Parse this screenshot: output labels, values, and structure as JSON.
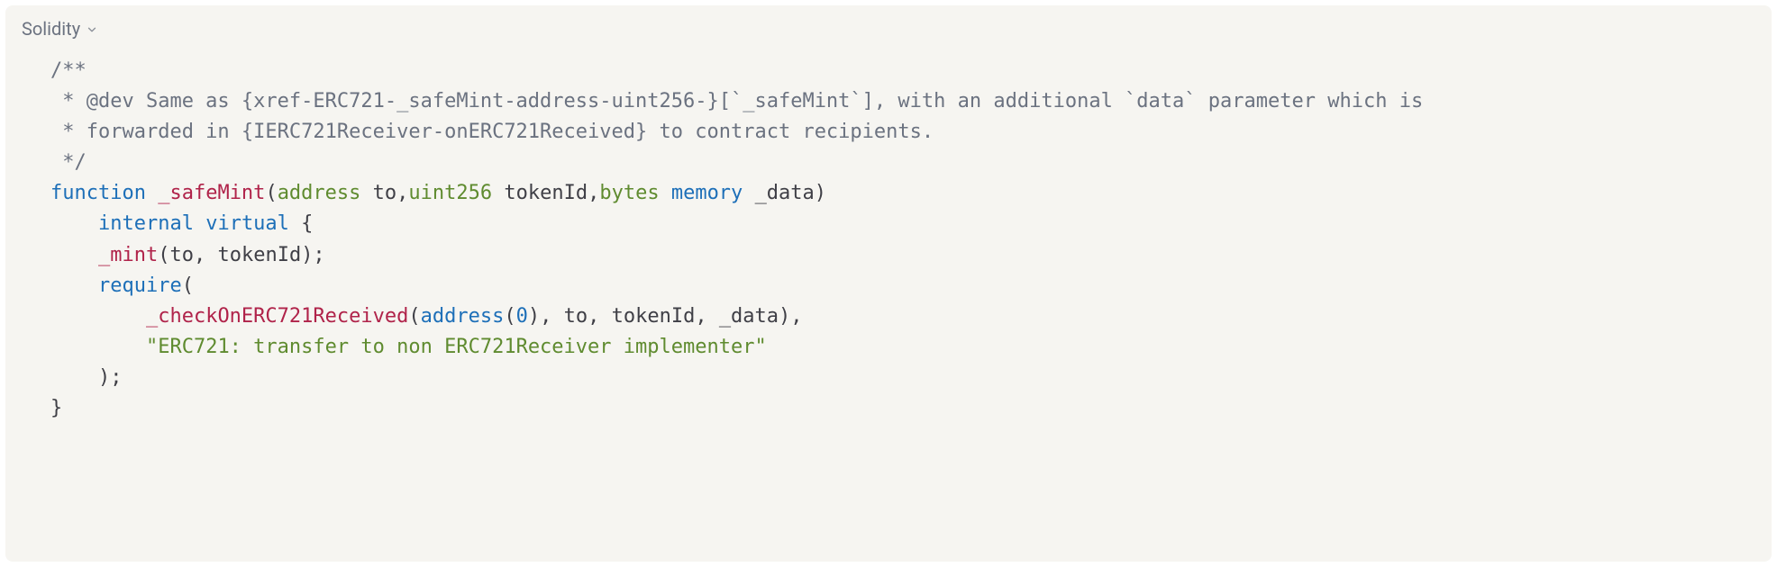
{
  "language": "Solidity",
  "tokens": [
    [
      [
        "comment",
        "/**"
      ]
    ],
    [
      [
        "comment",
        " * @dev Same as {xref-ERC721-_safeMint-address-uint256-}[`_safeMint`], with an additional `data` parameter which is"
      ]
    ],
    [
      [
        "comment",
        " * forwarded in {IERC721Receiver-onERC721Received} to contract recipients."
      ]
    ],
    [
      [
        "comment",
        " */"
      ]
    ],
    [
      [
        "keyword",
        "function"
      ],
      [
        "punct",
        " "
      ],
      [
        "fn",
        "_safeMint"
      ],
      [
        "punct",
        "("
      ],
      [
        "type",
        "address"
      ],
      [
        "punct",
        " "
      ],
      [
        "ident",
        "to"
      ],
      [
        "punct",
        ","
      ],
      [
        "type",
        "uint256"
      ],
      [
        "punct",
        " "
      ],
      [
        "ident",
        "tokenId"
      ],
      [
        "punct",
        ","
      ],
      [
        "type",
        "bytes"
      ],
      [
        "punct",
        " "
      ],
      [
        "keyword",
        "memory"
      ],
      [
        "punct",
        " "
      ],
      [
        "ident",
        "_data"
      ],
      [
        "punct",
        ")"
      ]
    ],
    [
      [
        "punct",
        "    "
      ],
      [
        "keyword",
        "internal"
      ],
      [
        "punct",
        " "
      ],
      [
        "keyword",
        "virtual"
      ],
      [
        "punct",
        " {"
      ]
    ],
    [
      [
        "punct",
        "    "
      ],
      [
        "fn",
        "_mint"
      ],
      [
        "punct",
        "("
      ],
      [
        "ident",
        "to"
      ],
      [
        "punct",
        ", "
      ],
      [
        "ident",
        "tokenId"
      ],
      [
        "punct",
        ");"
      ]
    ],
    [
      [
        "punct",
        "    "
      ],
      [
        "call",
        "require"
      ],
      [
        "punct",
        "("
      ]
    ],
    [
      [
        "punct",
        "        "
      ],
      [
        "fn",
        "_checkOnERC721Received"
      ],
      [
        "punct",
        "("
      ],
      [
        "call",
        "address"
      ],
      [
        "punct",
        "("
      ],
      [
        "num",
        "0"
      ],
      [
        "punct",
        "), "
      ],
      [
        "ident",
        "to"
      ],
      [
        "punct",
        ", "
      ],
      [
        "ident",
        "tokenId"
      ],
      [
        "punct",
        ", "
      ],
      [
        "ident",
        "_data"
      ],
      [
        "punct",
        "),"
      ]
    ],
    [
      [
        "punct",
        "        "
      ],
      [
        "str",
        "\"ERC721: transfer to non ERC721Receiver implementer\""
      ]
    ],
    [
      [
        "punct",
        "    );"
      ]
    ],
    [
      [
        "punct",
        "}"
      ]
    ]
  ]
}
